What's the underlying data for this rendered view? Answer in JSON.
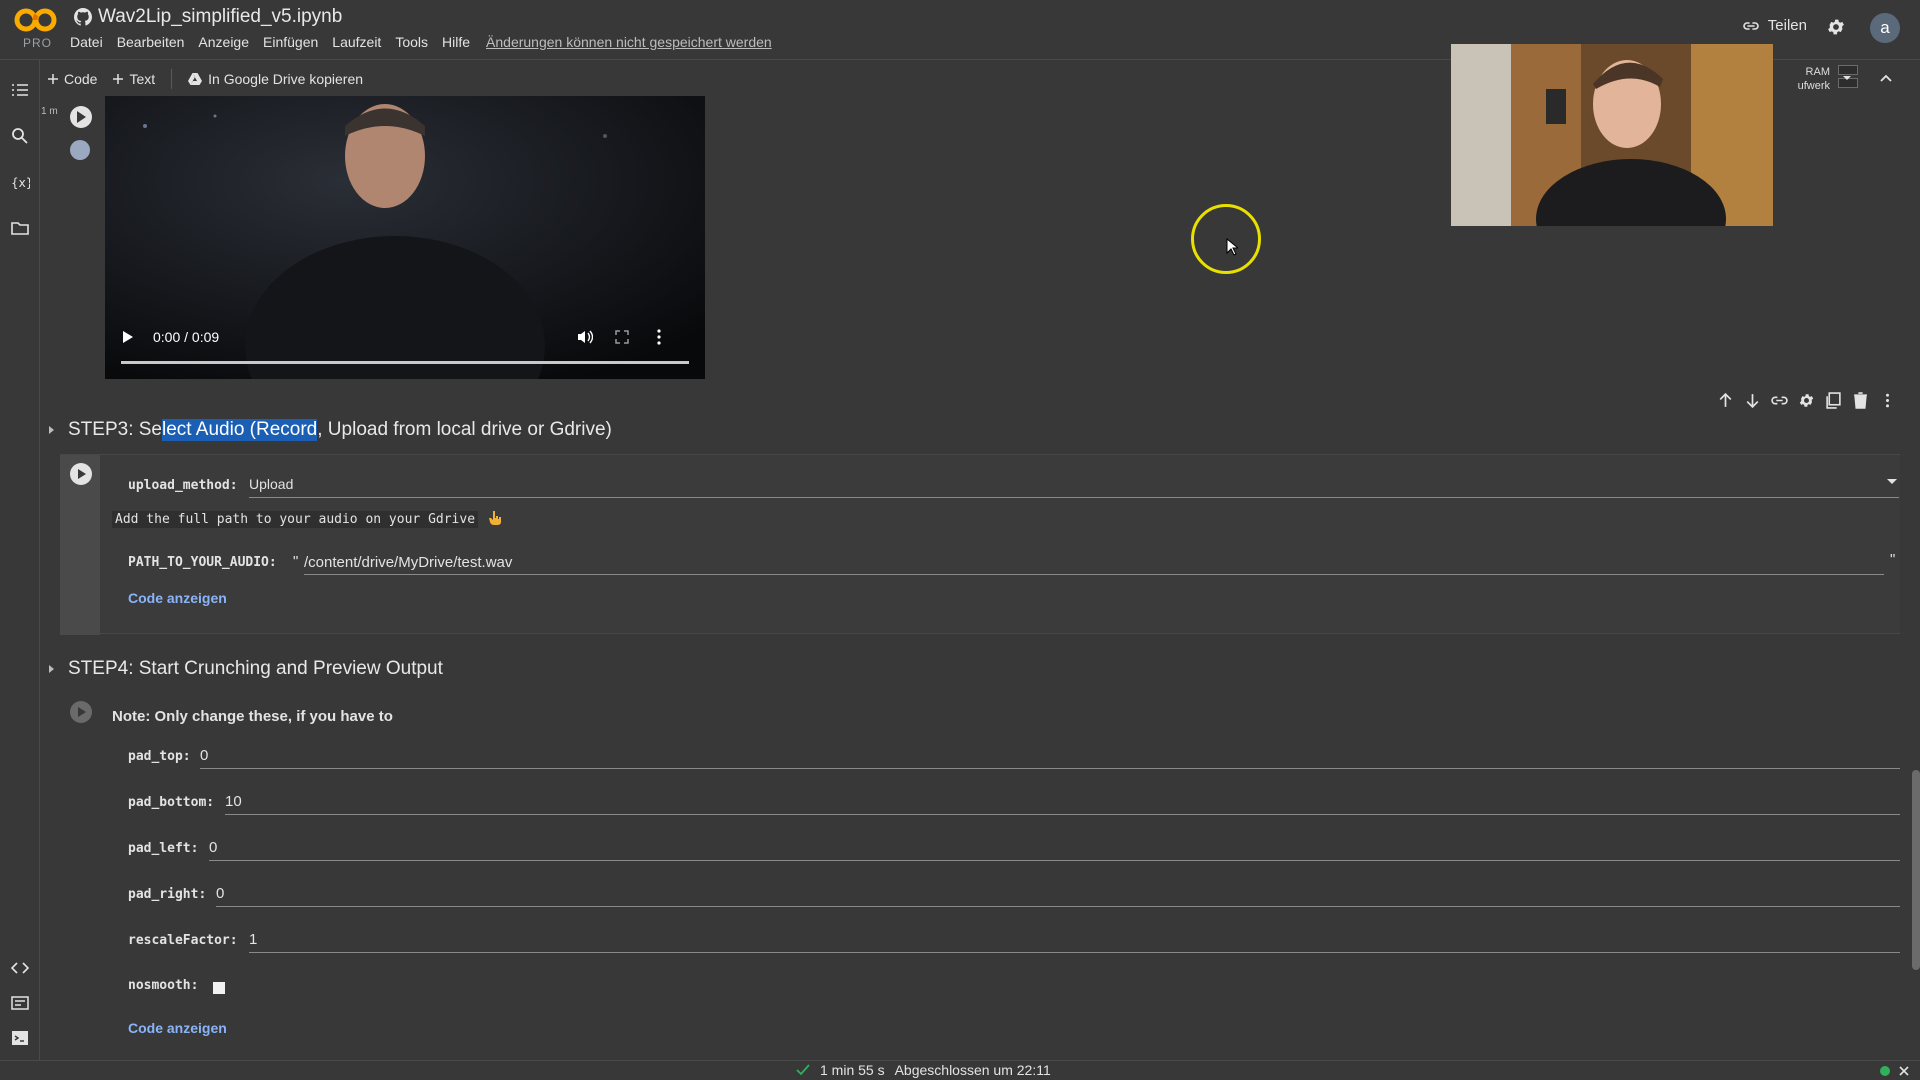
{
  "app": {
    "logo_text": "PRO",
    "notebook_title": "Wav2Lip_simplified_v5.ipynb"
  },
  "menu": {
    "items": [
      "Datei",
      "Bearbeiten",
      "Anzeige",
      "Einfügen",
      "Laufzeit",
      "Tools",
      "Hilfe"
    ],
    "unsaved_notice": "Änderungen können nicht gespeichert werden"
  },
  "header_right": {
    "share_label": "Teilen",
    "avatar_letter": "a"
  },
  "toolbar": {
    "code_label": "Code",
    "text_label": "Text",
    "drive_copy_label": "In Google Drive kopieren"
  },
  "resources": {
    "ram_label": "RAM",
    "disk_label": "ufwerk"
  },
  "video_cell": {
    "exec_label": "1 m",
    "time_display": "0:00 / 0:09"
  },
  "step3": {
    "heading_before": "STEP3: Se",
    "heading_selected": "lect Audio (Record",
    "heading_after": ", Upload from local drive or Gdrive)",
    "upload_method_label": "upload_method:",
    "upload_method_value": "Upload",
    "path_note": "Add the full path to your audio on your Gdrive",
    "path_label": "PATH_TO_YOUR_AUDIO:",
    "path_quote_open": "\"",
    "path_value": "/content/drive/MyDrive/test.wav",
    "path_quote_close": "\"",
    "show_code": "Code anzeigen"
  },
  "step4": {
    "heading": "STEP4: Start Crunching and Preview Output",
    "note": "Note: Only change these, if you have to",
    "fields": [
      {
        "label": "pad_top:",
        "value": "0"
      },
      {
        "label": "pad_bottom:",
        "value": "10"
      },
      {
        "label": "pad_left:",
        "value": "0"
      },
      {
        "label": "pad_right:",
        "value": "0"
      },
      {
        "label": "rescaleFactor:",
        "value": "1"
      }
    ],
    "nosmooth_label": "nosmooth:",
    "show_code": "Code anzeigen"
  },
  "status": {
    "duration": "1 min 55 s",
    "completed": "Abgeschlossen um 22:11"
  },
  "colors": {
    "background": "#383838",
    "link": "#8ab4f8",
    "selection": "#1a5fb4",
    "status_ok": "#2fb15c",
    "cursor_ring": "#e8e000"
  }
}
